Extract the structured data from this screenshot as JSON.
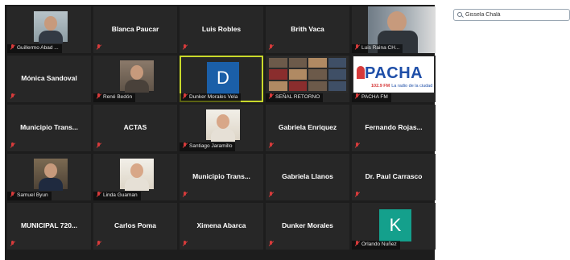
{
  "search": {
    "value": "Gissela Chalá"
  },
  "tiles": [
    {
      "kind": "video",
      "style": "",
      "caption": "Guillermo Abad ..."
    },
    {
      "kind": "name",
      "name": "Blanca Paucar"
    },
    {
      "kind": "name",
      "name": "Luis Robles"
    },
    {
      "kind": "name",
      "name": "Brith Vaca"
    },
    {
      "kind": "video",
      "style": "glasses",
      "caption": "Luis Raina CH..."
    },
    {
      "kind": "name",
      "name": "Mónica Sandoval"
    },
    {
      "kind": "video",
      "style": "office",
      "caption": "René Bedón"
    },
    {
      "kind": "avatar",
      "letter": "D",
      "color": "#1b5fa8",
      "caption": "Dunker Morales Vela",
      "active": true
    },
    {
      "kind": "collage",
      "caption": "SEÑAL RETORNO"
    },
    {
      "kind": "brand",
      "caption": "PACHA FM",
      "logo": "PACHA",
      "freq": "102.9 FM",
      "tagline": "La radio de la ciudad"
    },
    {
      "kind": "name",
      "name": "Municipio  Trans..."
    },
    {
      "kind": "name",
      "name": "ACTAS"
    },
    {
      "kind": "video",
      "style": "warm",
      "caption": "Santiago Jaramillo"
    },
    {
      "kind": "name",
      "name": "Gabriela Enriquez"
    },
    {
      "kind": "name",
      "name": "Fernando  Rojas..."
    },
    {
      "kind": "video",
      "style": "shelf",
      "caption": "Samuel Byun"
    },
    {
      "kind": "video",
      "style": "warm",
      "caption": "Linda Guaman"
    },
    {
      "kind": "name",
      "name": "Municipio  Trans..."
    },
    {
      "kind": "name",
      "name": "Gabriela Llanos"
    },
    {
      "kind": "name",
      "name": "Dr. Paul Carrasco"
    },
    {
      "kind": "name",
      "name": "MUNICIPAL  720..."
    },
    {
      "kind": "name",
      "name": "Carlos Poma"
    },
    {
      "kind": "name",
      "name": "Ximena Abarca"
    },
    {
      "kind": "name",
      "name": "Dunker Morales"
    },
    {
      "kind": "avatar",
      "letter": "K",
      "color": "#14a08c",
      "caption": "Orlando Nuñez"
    }
  ]
}
